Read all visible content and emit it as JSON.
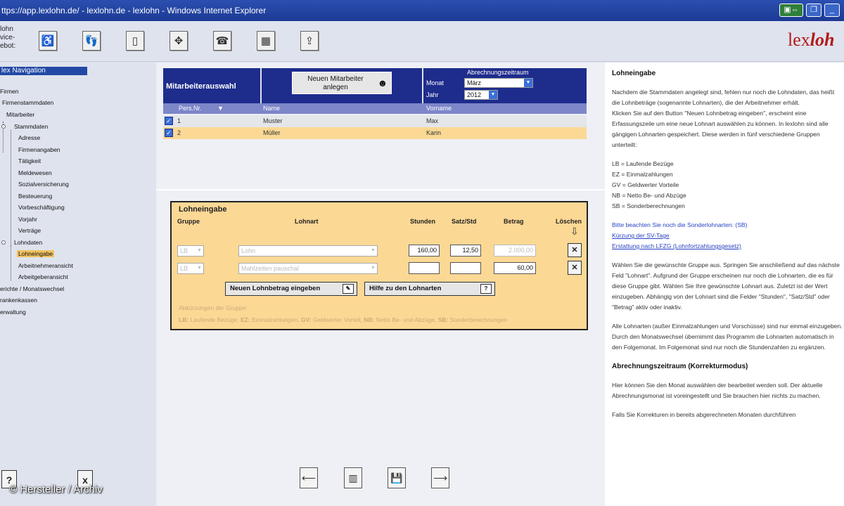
{
  "window": {
    "title": "ttps://app.lexlohn.de/ - lexlohn.de - lexlohn - Windows Internet Explorer"
  },
  "toolbar": {
    "label_line1": "lohn",
    "label_line2": "vice-",
    "label_line3": "ebot:",
    "logo_a": "lex",
    "logo_b": "loh"
  },
  "sidebar": {
    "header": "lex Navigation",
    "items": [
      "Firmen",
      "Firmenstammdaten",
      "Mitarbeiter",
      "Stammdaten",
      "Adresse",
      "Firmenangaben",
      "Tätigkeit",
      "Meldewesen",
      "Sozialversicherung",
      "Besteuerung",
      "Vorbeschäftigung",
      "Vorjahr",
      "Verträge",
      "Lohndaten",
      "Lohneingabe",
      "Arbeitnehmeransicht",
      "Arbeitgeberansicht",
      "erichte / Monatswechsel",
      "rankenkassen",
      "erwaltung"
    ],
    "bottom_help": "?",
    "bottom_close": "x"
  },
  "employee": {
    "title": "Mitarbeiterauswahl",
    "new_button_l1": "Neuen Mitarbeiter",
    "new_button_l2": "anlegen",
    "period_title": "Abrechnungszeitraum",
    "month_label": "Monat",
    "month_value": "März",
    "year_label": "Jahr",
    "year_value": "2012",
    "columns": {
      "nr": "Pers.Nr.",
      "name": "Name",
      "first": "Vorname"
    },
    "rows": [
      {
        "nr": "1",
        "name": "Muster",
        "first": "Max"
      },
      {
        "nr": "2",
        "name": "Müller",
        "first": "Karin"
      }
    ]
  },
  "lohn": {
    "title": "Lohneingabe",
    "cols": {
      "group": "Gruppe",
      "type": "Lohnart",
      "hours": "Stunden",
      "rate": "Satz/Std",
      "amount": "Betrag",
      "delete": "Löschen"
    },
    "rows": [
      {
        "group": "LB",
        "type": "Lohn",
        "hours": "160,00",
        "rate": "12,50",
        "amount": "2.000,00"
      },
      {
        "group": "LB",
        "type": "Mahlzeiten pauschal",
        "hours": "",
        "rate": "",
        "amount": "60,00"
      }
    ],
    "btn_new": "Neuen Lohnbetrag eingeben",
    "btn_help": "Hilfe zu den Lohnarten",
    "abbr_title": "Abkürzungen der Gruppe:",
    "abbr": [
      {
        "k": "LB:",
        "v": "Laufende Bezüge,"
      },
      {
        "k": "EZ:",
        "v": "Einmalzahlungen,"
      },
      {
        "k": "GV:",
        "v": "Geldwerter Vorteil,"
      },
      {
        "k": "NB:",
        "v": "Netto Be- und Abzüge,"
      },
      {
        "k": "SB:",
        "v": "Sonderberechnungen"
      }
    ]
  },
  "help": {
    "title": "Lohneingabe",
    "p1": "Nachdem die Stammdaten angelegt sind, fehlen nur noch die Lohndaten, das heißt die Lohnbeträge (sogenannte Lohnarten), die der Arbeitnehmer erhält.",
    "p2": "Klicken Sie auf den Button \"Neuen Lohnbetrag eingeben\", erscheint eine Erfassungszeile um eine neue Lohnart auswählen zu können. In lexlohn sind alle gängigen Lohnarten gespeichert. Diese werden in fünf verschiedene Gruppen unterteilt:",
    "groups": [
      "LB = Laufende Bezüge",
      "EZ = Einmalzahlungen",
      "GV = Geldwerter Vorteile",
      "NB = Netto Be- und Abzüge",
      "SB = Sonderberechnungen"
    ],
    "note": "Bitte beachten Sie noch die Sonderlohnarten: (SB)",
    "link1": "Kürzung der SV-Tage",
    "link2": "Erstattung nach LFZG (Lohnfortzahlungsgesetz)",
    "p3": "Wählen Sie die gewünschte Gruppe aus. Springen Sie anschließend auf das nächste Feld \"Lohnart\". Aufgrund der Gruppe erscheinen nur noch die Lohnarten, die es für diese Gruppe gibt. Wählen Sie Ihre gewünschte Lohnart aus. Zuletzt ist der Wert einzugeben. Abhängig von der Lohnart sind die Felder \"Stunden\", \"Satz/Std\" oder \"Betrag\" aktiv oder inaktiv.",
    "p4": "Alle Lohnarten (außer Einmalzahlungen und Vorschüsse) sind nur einmal einzugeben. Durch den Monatswechsel übernimmt das Programm die Lohnarten automatisch in den Folgemonat. Im Folgemonat sind nur noch die Stundenzahlen zu ergänzen.",
    "title2": "Abrechnungszeitraum (Korrekturmodus)",
    "p5": "Hier können Sie den Monat auswählen der bearbeitet werden soll. Der aktuelle Abrechnungsmonat ist voreingestellt und Sie brauchen hier nichts zu machen.",
    "p6": "Falls Sie Korrekturen in bereits abgerechneten Monaten durchführen"
  },
  "credit": "© Hersteller / Archiv"
}
